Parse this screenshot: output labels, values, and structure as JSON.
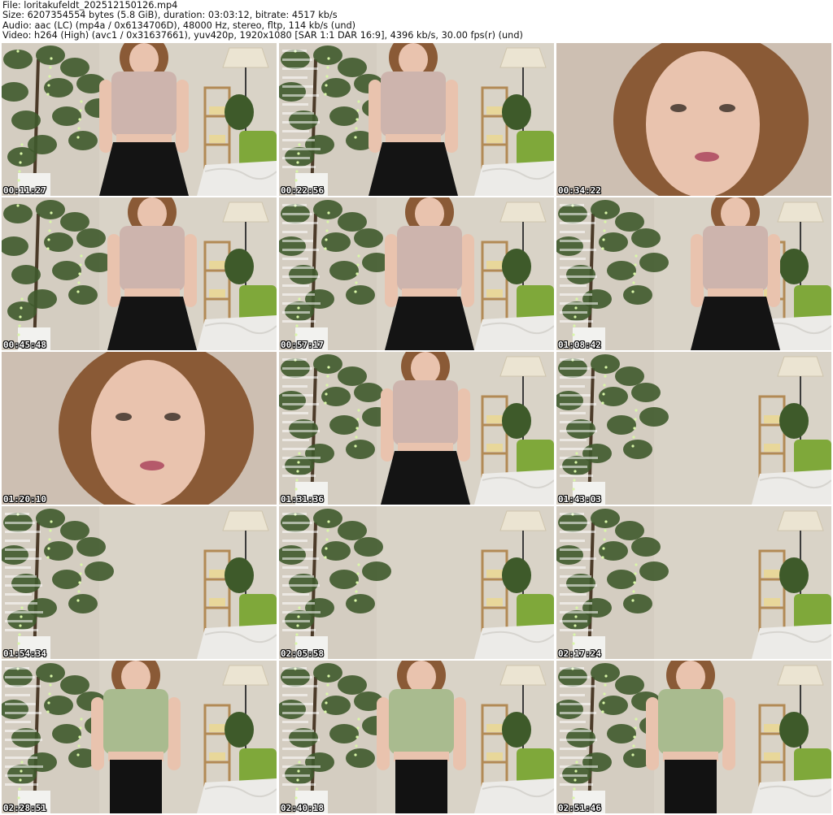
{
  "header": {
    "file": "File: loritakufeldt_202512150126.mp4",
    "size": "Size: 6207354554 bytes (5.8 GiB), duration: 03:03:12, bitrate: 4517 kb/s",
    "audio": "Audio: aac (LC) (mp4a / 0x6134706D), 48000 Hz, stereo, fltp, 114 kb/s (und)",
    "video": "Video: h264 (High) (avc1 / 0x31637661), yuv420p, 1920x1080 [SAR 1:1 DAR 16:9], 4396 kb/s, 30.00 fps(r) (und)"
  },
  "thumbnails": [
    {
      "timestamp": "00:11:27",
      "scene": "person",
      "top": "pink-top",
      "bottom": "black-skirt"
    },
    {
      "timestamp": "00:22:56",
      "scene": "person",
      "top": "pink-top",
      "bottom": "black-skirt"
    },
    {
      "timestamp": "00:34:22",
      "scene": "face"
    },
    {
      "timestamp": "00:45:48",
      "scene": "person",
      "top": "pink-top",
      "bottom": "black-skirt"
    },
    {
      "timestamp": "00:57:17",
      "scene": "person",
      "top": "pink-top",
      "bottom": "black-skirt"
    },
    {
      "timestamp": "01:08:42",
      "scene": "person",
      "top": "pink-top",
      "bottom": "black-skirt"
    },
    {
      "timestamp": "01:20:10",
      "scene": "face"
    },
    {
      "timestamp": "01:31:36",
      "scene": "person",
      "top": "pink-top",
      "bottom": "black-skirt"
    },
    {
      "timestamp": "01:43:03",
      "scene": "empty-room"
    },
    {
      "timestamp": "01:54:34",
      "scene": "empty-room"
    },
    {
      "timestamp": "02:05:58",
      "scene": "empty-room"
    },
    {
      "timestamp": "02:17:24",
      "scene": "empty-room"
    },
    {
      "timestamp": "02:28:51",
      "scene": "person",
      "top": "green-top",
      "bottom": "black-leggings"
    },
    {
      "timestamp": "02:40:18",
      "scene": "person",
      "top": "green-top",
      "bottom": "black-leggings"
    },
    {
      "timestamp": "02:51:46",
      "scene": "person",
      "top": "green-top",
      "bottom": "black-leggings"
    }
  ],
  "colors": {
    "wall": "#d9d3c7",
    "plant": "#3f5a2c",
    "sofa": "#7fa83a",
    "bed": "#ecebe8",
    "pink-top": "#cdb4ad",
    "green-top": "#a9bb8f",
    "black-skirt": "#141414",
    "black-leggings": "#121212",
    "hair": "#8a5a36",
    "skin": "#e9c3ae"
  }
}
